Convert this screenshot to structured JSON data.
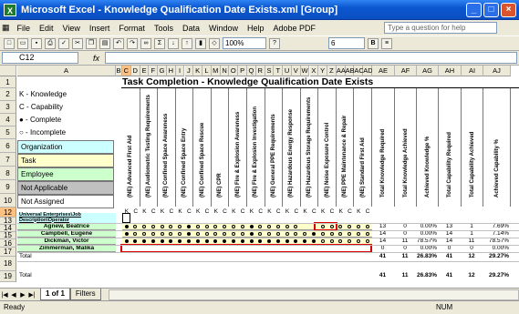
{
  "window": {
    "title": "Microsoft Excel - Knowledge Qualification Date Exists.xml  [Group]",
    "icon": "excel-icon"
  },
  "menu": [
    "File",
    "Edit",
    "View",
    "Insert",
    "Format",
    "Tools",
    "Data",
    "Window",
    "Help",
    "Adobe PDF"
  ],
  "help_placeholder": "Type a question for help",
  "toolbar": {
    "zoom": "100%",
    "font_size": "6"
  },
  "formula": {
    "cell_ref": "C12",
    "fx": "fx",
    "value": ""
  },
  "columns": [
    "A",
    "B",
    "C",
    "D",
    "E",
    "F",
    "G",
    "H",
    "I",
    "J",
    "K",
    "L",
    "M",
    "N",
    "O",
    "P",
    "Q",
    "R",
    "S",
    "T",
    "U",
    "V",
    "W",
    "X",
    "Y",
    "Z",
    "AA",
    "AB",
    "AC",
    "AD",
    "AE",
    "AF",
    "AG",
    "AH",
    "AI",
    "AJ"
  ],
  "sheet": {
    "title": "Task Completion  - Knowledge Qualification Date Exists",
    "key": [
      "K - Knowledge",
      "C - Capability",
      "● - Complete",
      "○ - Incomplete"
    ],
    "legend": [
      {
        "label": "Organization",
        "color": "#ccffff"
      },
      {
        "label": "Task",
        "color": "#ffffcc"
      },
      {
        "label": "Employee",
        "color": "#ccffcc"
      },
      {
        "label": "Not Applicable",
        "color": "#c0c0c0"
      },
      {
        "label": "Not Assigned",
        "color": "#ffffff"
      }
    ],
    "tasks": [
      "(NE) Advanced First Aid",
      "(NE) Audiometric Testing Requirements",
      "(NE) Confined Space Awareness",
      "(NE) Confined Space Entry",
      "(NE) Confined Space Rescue",
      "(NE) CPR",
      "(NE) Fire & Explosion Awareness",
      "(NE) Fire & Explosion Investigation",
      "(NE) General PPE Requirements",
      "(NE) Hazardous Energy Response",
      "(NE) Hazardous Storage Requirements",
      "(NE) Noise Exposure Control",
      "(NE) PPE Maintenance & Repair",
      "(NE) Standard First Aid"
    ],
    "summary_headers": [
      "Total Knowledge Required",
      "Total Knowledge Achieved",
      "Achieved Knowledge %",
      "Total Capability Required",
      "Total Capability Achieved",
      "Achieved Capability %"
    ],
    "kc": [
      "K",
      "C"
    ],
    "org_label": "Universal Enterprises\\Job Description\\Operator",
    "employees": [
      {
        "name": "Agnew, Beatrice",
        "stats": [
          "13",
          "0",
          "0.00%",
          "13",
          "1",
          "7.69%"
        ]
      },
      {
        "name": "Campbell, Eugene",
        "stats": [
          "14",
          "0",
          "0.00%",
          "14",
          "1",
          "7.14%"
        ]
      },
      {
        "name": "Dickman, Victor",
        "stats": [
          "14",
          "11",
          "78.57%",
          "14",
          "11",
          "78.57%"
        ]
      },
      {
        "name": "Zimmerman, Malika",
        "stats": [
          "0",
          "0",
          "0.00%",
          "0",
          "0",
          "0.00%"
        ]
      }
    ],
    "total_label": "Total",
    "total_stats": [
      "41",
      "11",
      "26.83%",
      "41",
      "12",
      "29.27%"
    ],
    "rows": [
      "1",
      "2",
      "3",
      "4",
      "5",
      "6",
      "7",
      "8",
      "9",
      "10",
      "11",
      "12",
      "13",
      "14",
      "15",
      "16",
      "17",
      "18",
      "19"
    ]
  },
  "tabs": [
    "1 of 1",
    "Filters"
  ],
  "status": {
    "left": "Ready",
    "right": "NUM"
  }
}
